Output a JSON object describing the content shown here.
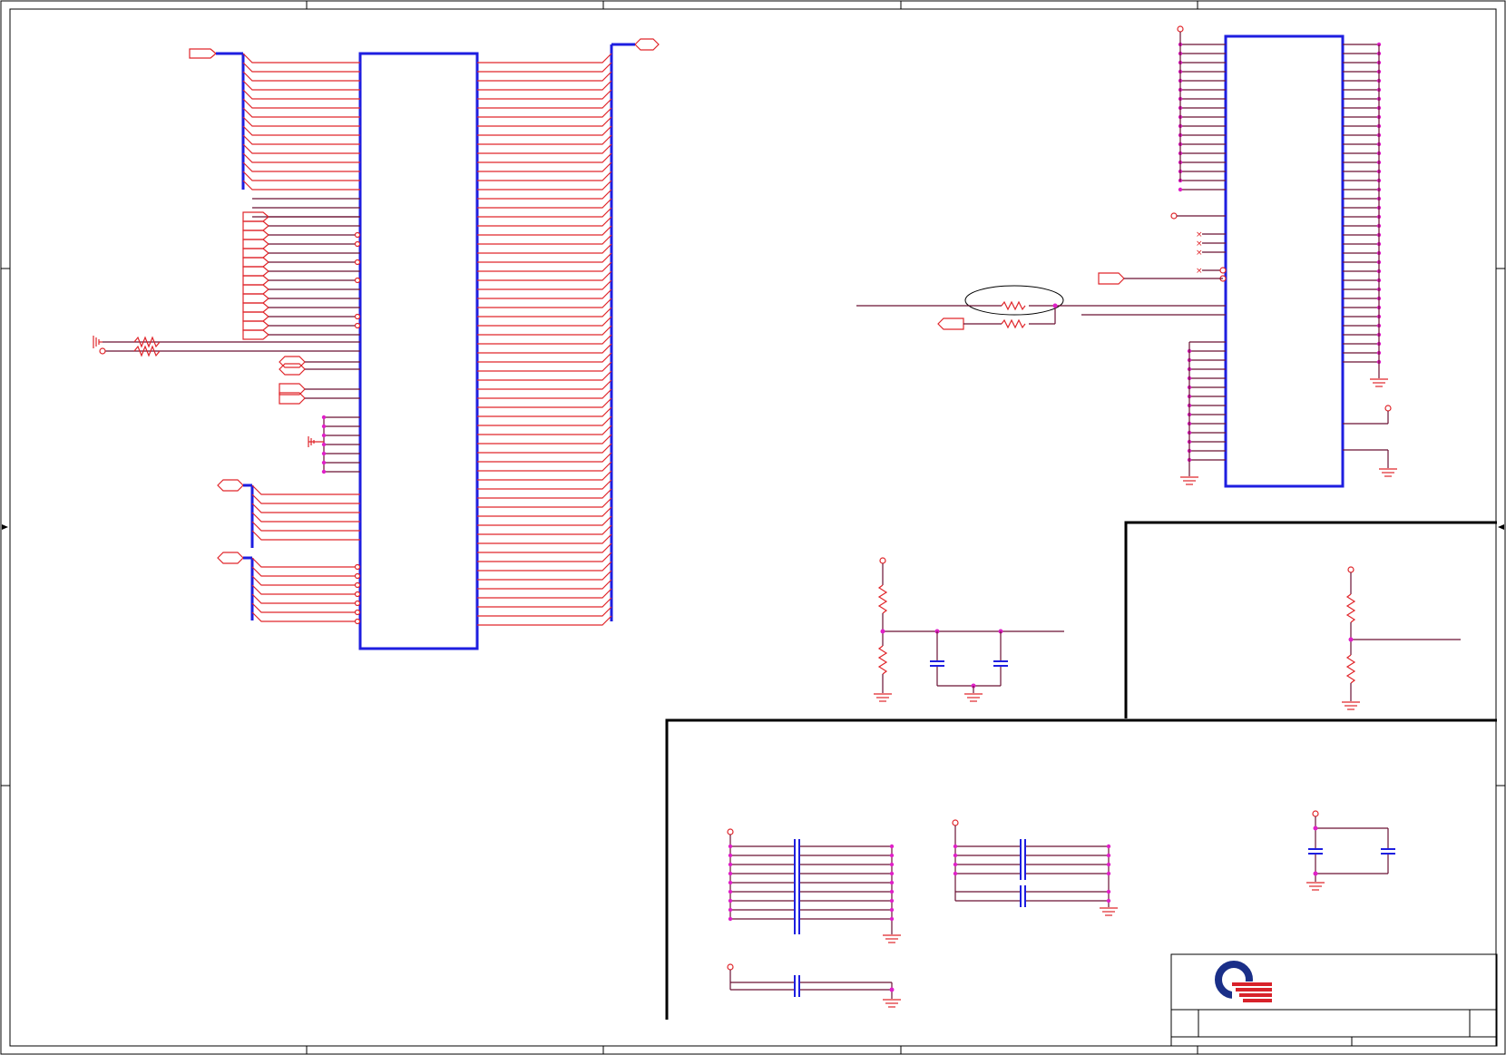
{
  "schematic": {
    "colors": {
      "wire": "#e0262b",
      "net": "#6b1133",
      "bus": "#1e1ee0",
      "junction": "#e020c8",
      "frame": "#000000"
    },
    "components": {
      "main_connector": "ic-symbol",
      "right_device": "ic-symbol",
      "resistor": "resistor-symbol",
      "capacitor": "capacitor-symbol",
      "ground": "ground-symbol",
      "power": "power-symbol"
    },
    "title_block": {
      "logo": "company-logo"
    }
  }
}
